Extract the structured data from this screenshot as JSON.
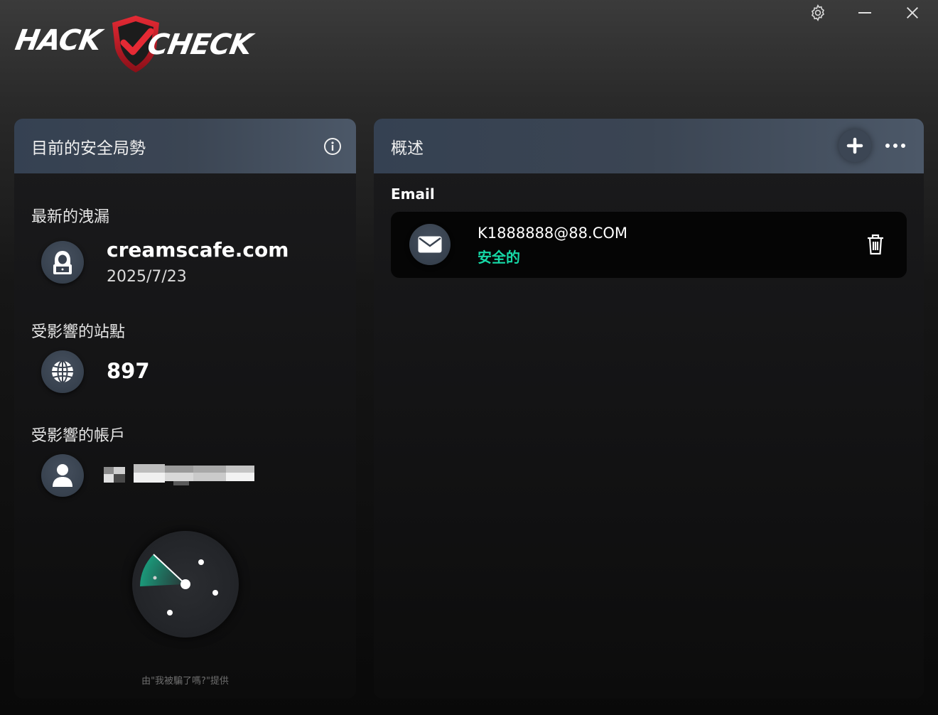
{
  "app": {
    "logo_text_left": "HACK",
    "logo_text_right": "CHECK",
    "accent_red": "#d7202c",
    "accent_green": "#16d8a6"
  },
  "window_controls": {
    "settings_icon": "gear-icon",
    "minimize_icon": "minimize-icon",
    "close_icon": "close-icon"
  },
  "left_panel": {
    "title": "目前的安全局勢",
    "latest_breach": {
      "label": "最新的洩漏",
      "site": "creamscafe.com",
      "date": "2025/7/23",
      "icon": "hacker-icon"
    },
    "affected_sites": {
      "label": "受影響的站點",
      "count": "897",
      "icon": "globe-icon"
    },
    "affected_accounts": {
      "label": "受影響的帳戶",
      "icon": "user-icon"
    },
    "credit": "由\"我被騙了嗎?\"提供"
  },
  "right_panel": {
    "title": "概述",
    "section_label": "Email",
    "items": [
      {
        "address": "K1888888@88.COM",
        "status": "安全的",
        "icon": "mail-icon"
      }
    ]
  }
}
